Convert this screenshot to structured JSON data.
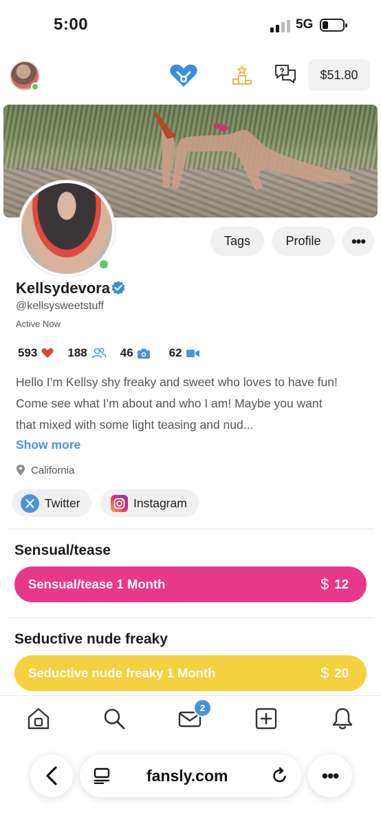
{
  "status_bar": {
    "time": "5:00",
    "network": "5G"
  },
  "header": {
    "balance": "$51.80"
  },
  "profile": {
    "display_name": "Kellsydevora",
    "handle": "@kellsysweetstuff",
    "status": "Active Now",
    "stats": {
      "likes": "593",
      "subscribers": "188",
      "photos": "46",
      "videos": "62"
    },
    "bio_lines": [
      "Hello I’m Kellsy shy freaky and sweet who loves to have fun!",
      "Come see what I’m about and who I am! Maybe you want",
      "that mixed with some light teasing and nud..."
    ],
    "show_more": "Show more",
    "location": "California",
    "buttons": {
      "tags": "Tags",
      "profile": "Profile",
      "more": "•••"
    },
    "socials": {
      "twitter": "Twitter",
      "instagram": "Instagram"
    }
  },
  "tiers": [
    {
      "title": "Sensual/tease",
      "button_label": "Sensual/tease 1 Month",
      "currency": "$",
      "price": "12",
      "color": "#e8388a"
    },
    {
      "title": "Seductive nude freaky",
      "button_label": "Seductive nude freaky 1 Month",
      "currency": "$",
      "price": "20",
      "color": "#f4d13e"
    }
  ],
  "bottom_nav": {
    "messages_badge": "2"
  },
  "browser": {
    "url": "fansly.com",
    "menu": "•••"
  },
  "colors": {
    "accent_blue": "#4b93d8",
    "online_green": "#5cc76a",
    "gold": "#e2b33a"
  }
}
